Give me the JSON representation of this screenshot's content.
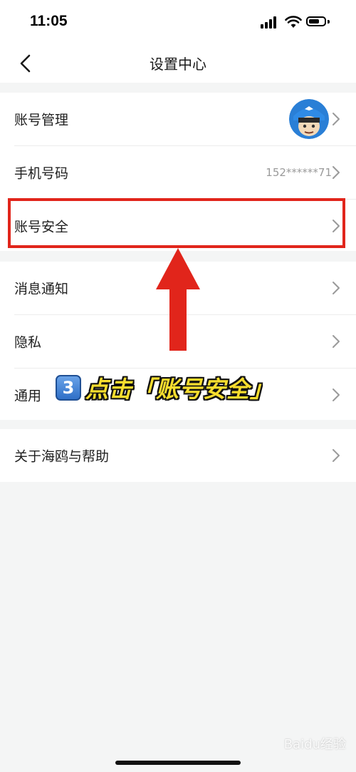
{
  "status_bar": {
    "time": "11:05"
  },
  "nav": {
    "title": "设置中心"
  },
  "groups": [
    {
      "items": [
        {
          "label": "账号管理"
        },
        {
          "label": "手机号码",
          "value": "152******71"
        },
        {
          "label": "账号安全"
        }
      ]
    },
    {
      "items": [
        {
          "label": "消息通知"
        },
        {
          "label": "隐私"
        },
        {
          "label": "通用"
        }
      ]
    },
    {
      "items": [
        {
          "label": "关于海鸥与帮助"
        }
      ]
    }
  ],
  "annotation": {
    "step": "3",
    "text": "点击「账号安全」"
  },
  "colors": {
    "highlight": "#e1251b",
    "annotation_text": "#f7dd2e"
  },
  "watermark": "Baidu经验"
}
